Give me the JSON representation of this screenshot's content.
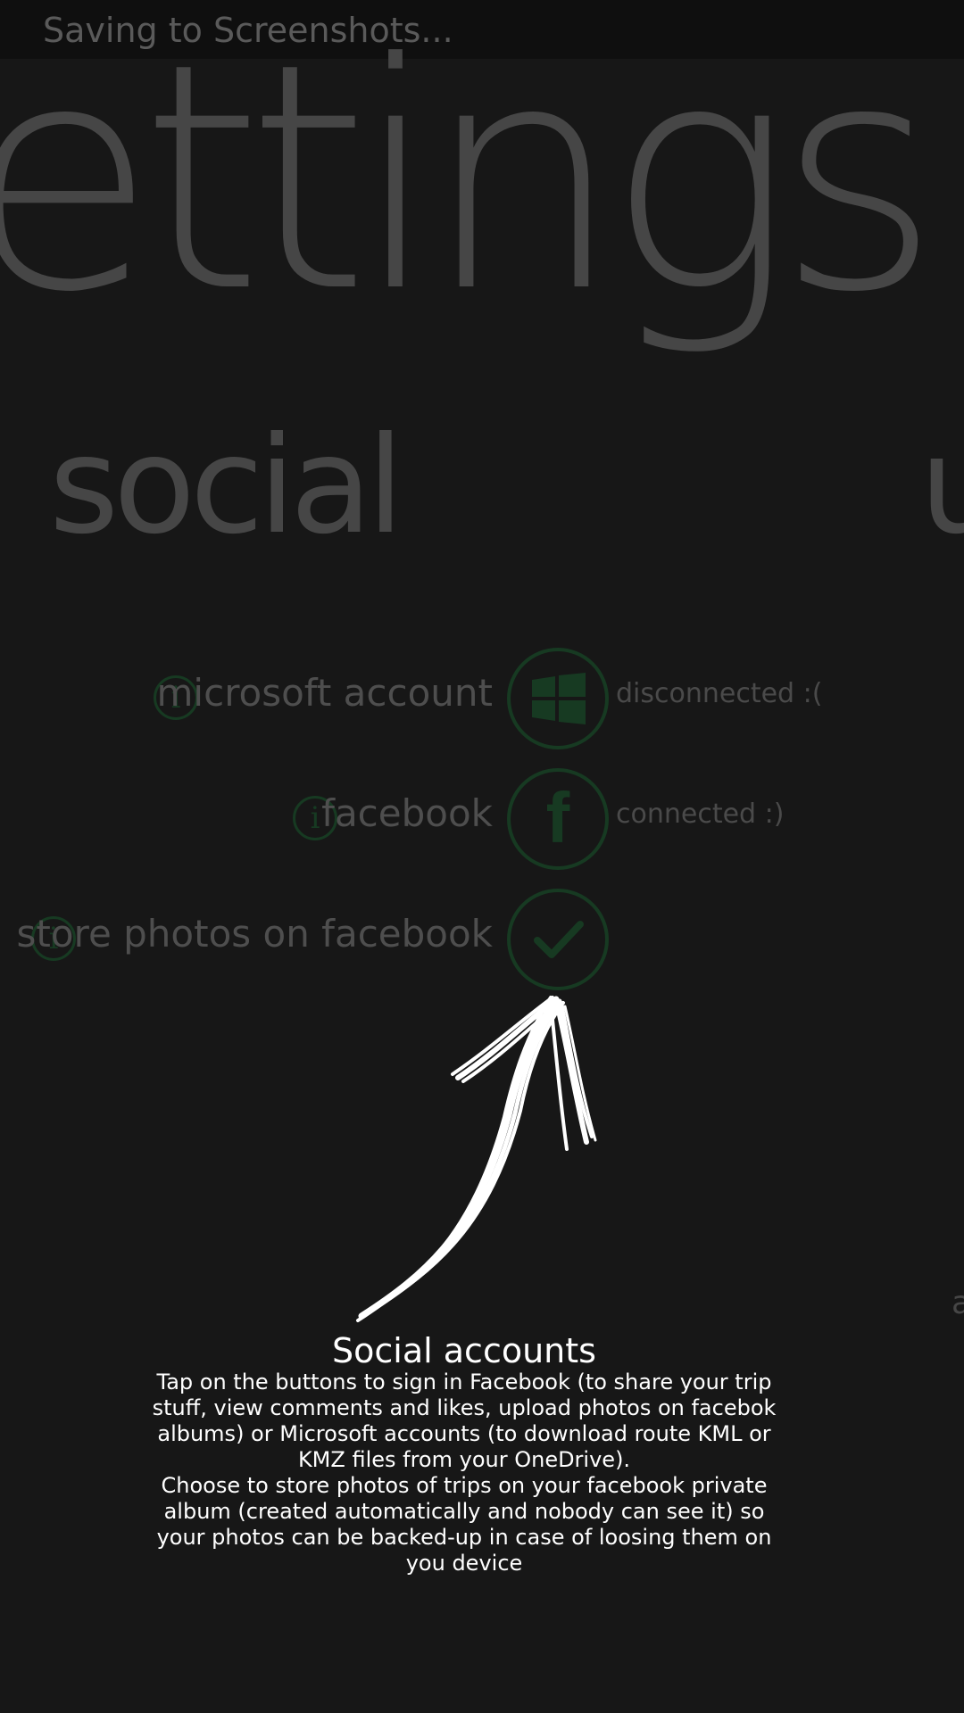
{
  "status_bar": {
    "text": "Saving to Screenshots..."
  },
  "page": {
    "title": "ettings",
    "pivot_current": "social",
    "pivot_next": "u",
    "edge_letter": "a"
  },
  "accounts": [
    {
      "label": "microsoft account",
      "icon": "windows-logo-icon",
      "status": "disconnected :("
    },
    {
      "label": "facebook",
      "icon": "facebook-logo-icon",
      "status": "connected :)"
    },
    {
      "label": "store photos on facebook",
      "icon": "checkmark-icon",
      "status": ""
    }
  ],
  "info_glyph": "i",
  "fb_glyph": "f",
  "help": {
    "title": "Social accounts",
    "paragraph1": "Tap on the buttons to sign in Facebook (to share your trip stuff, view comments and likes, upload photos on facebok albums) or Microsoft accounts (to download route KML or KMZ files from your OneDrive).",
    "paragraph2": "Choose to store photos of trips on your facebook private album (created automatically and nobody can see it) so your photos can be backed-up in case of loosing them on you device"
  },
  "colors": {
    "background": "#171717",
    "accent_dim": "#173a22",
    "ghost_text": "#464646",
    "overlay_text": "#ffffff"
  }
}
